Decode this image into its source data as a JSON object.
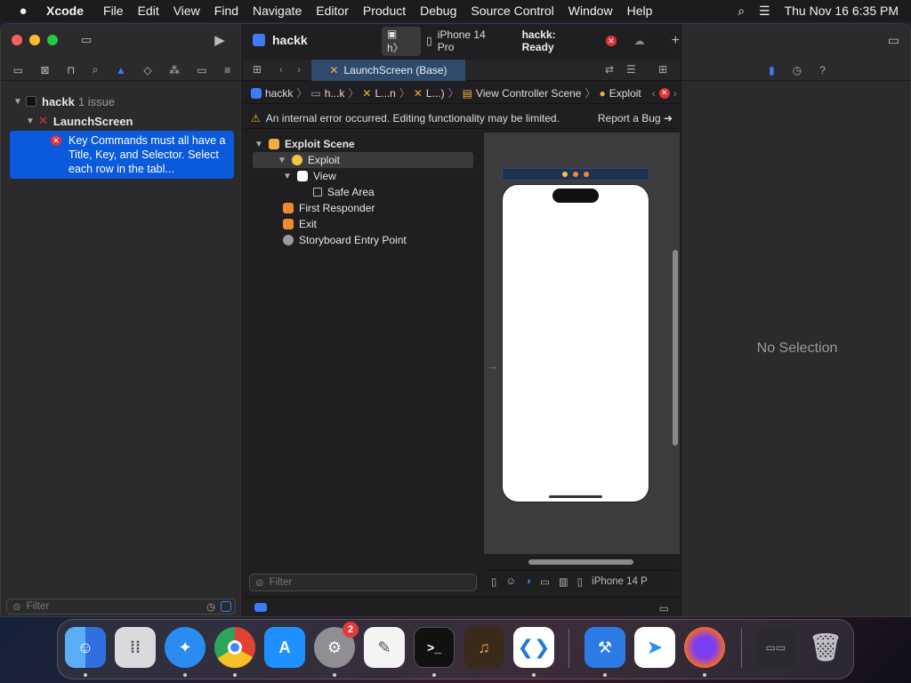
{
  "menubar": {
    "apple": "",
    "items": [
      "Xcode",
      "File",
      "Edit",
      "View",
      "Find",
      "Navigate",
      "Editor",
      "Product",
      "Debug",
      "Source Control",
      "Window",
      "Help"
    ],
    "clock": "Thu Nov 16  6:35 PM"
  },
  "toolbar": {
    "project": "hackk",
    "scheme": "h〉",
    "device": "iPhone 14 Pro",
    "status": "hackk: Ready"
  },
  "navigator": {
    "project_name": "hackk",
    "issue_count": "1 issue",
    "file_name": "LaunchScreen",
    "issue_text": "Key Commands must all have a Title, Key, and Selector. Select each row in the tabl...",
    "filter_placeholder": "Filter"
  },
  "editor": {
    "tab_label": "LaunchScreen (Base)",
    "jumpbar": [
      "hackk",
      "h...k",
      "L...n",
      "L...)",
      "View Controller Scene",
      "Exploit"
    ],
    "warning": "An internal error occurred. Editing functionality may be limited.",
    "report_bug": "Report a Bug",
    "outline": {
      "scene": "Exploit Scene",
      "controller": "Exploit",
      "view": "View",
      "safe_area": "Safe Area",
      "first_responder": "First Responder",
      "exit": "Exit",
      "entry_point": "Storyboard Entry Point"
    },
    "filter_placeholder": "Filter",
    "device_label": "iPhone 14 P"
  },
  "inspector": {
    "empty": "No Selection"
  },
  "dock": {
    "settings_badge": "2"
  },
  "colors": {
    "accent": "#3d7bf7",
    "error": "#e0303a",
    "selection": "#0a5adb"
  }
}
